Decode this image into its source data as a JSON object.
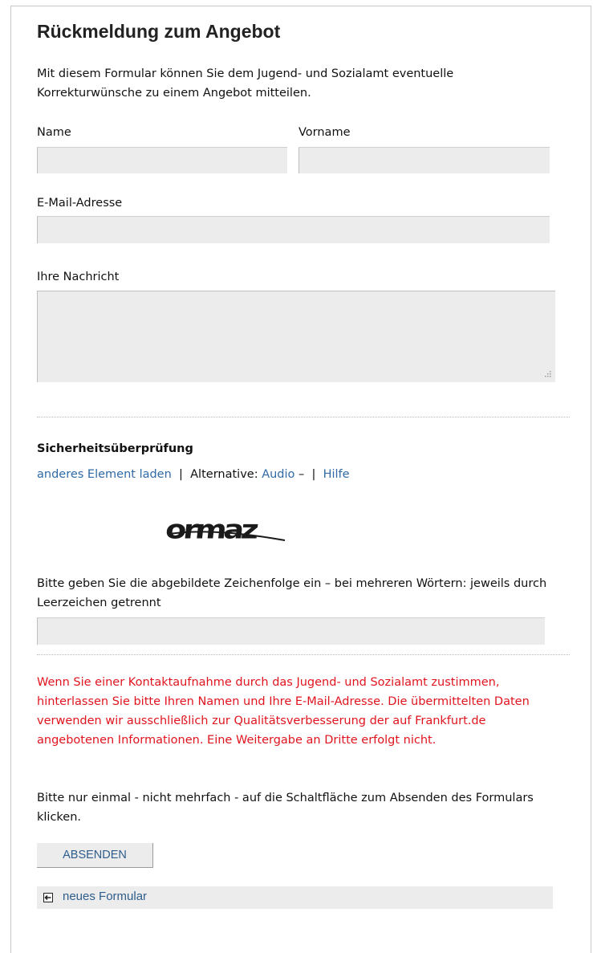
{
  "heading": "Rückmeldung zum Angebot",
  "intro_text": "Mit diesem Formular können Sie dem Jugend- und Sozialamt eventuelle Korrekturwünsche zu einem Angebot mitteilen.",
  "fields": {
    "name_label": "Name",
    "name_value": "",
    "vorname_label": "Vorname",
    "vorname_value": "",
    "email_label": "E-Mail-Adresse",
    "email_value": "",
    "message_label": "Ihre Nachricht",
    "message_value": ""
  },
  "security": {
    "title": "Sicherheitsüberprüfung",
    "reload_link": "anderes Element laden",
    "separator": "|",
    "alternative_label": "Alternative:",
    "audio_link": "Audio",
    "dash": "–",
    "help_link": "Hilfe",
    "captcha_text": "ormaz",
    "hint": "Bitte geben Sie die abgebildete Zeichenfolge ein – bei mehreren Wörtern: jeweils durch Leerzeichen getrennt",
    "captcha_value": ""
  },
  "notice": {
    "consent_text": "Wenn Sie einer Kontaktaufnahme durch das Jugend- und Sozialamt zustimmen, hinterlassen Sie bitte Ihren Namen und Ihre E-Mail-Adresse. Die übermittelten Daten verwenden wir ausschließlich zur Qualitätsverbesserung der auf Frankfurt.de angebotenen Informationen. Eine Weitergabe an Dritte erfolgt nicht.",
    "submit_hint": "Bitte nur einmal - nicht mehrfach - auf die Schaltfläche zum Absenden des Formulars klicken."
  },
  "actions": {
    "submit_label": "ABSENDEN",
    "new_form_label": "neues Formular"
  },
  "colors": {
    "link": "#2f6aa6",
    "notice_red": "#e0141e",
    "field_bg": "#ececec"
  },
  "icons": {
    "resize": "resize-grip-icon",
    "new_form": "boxed-arrow-icon"
  }
}
